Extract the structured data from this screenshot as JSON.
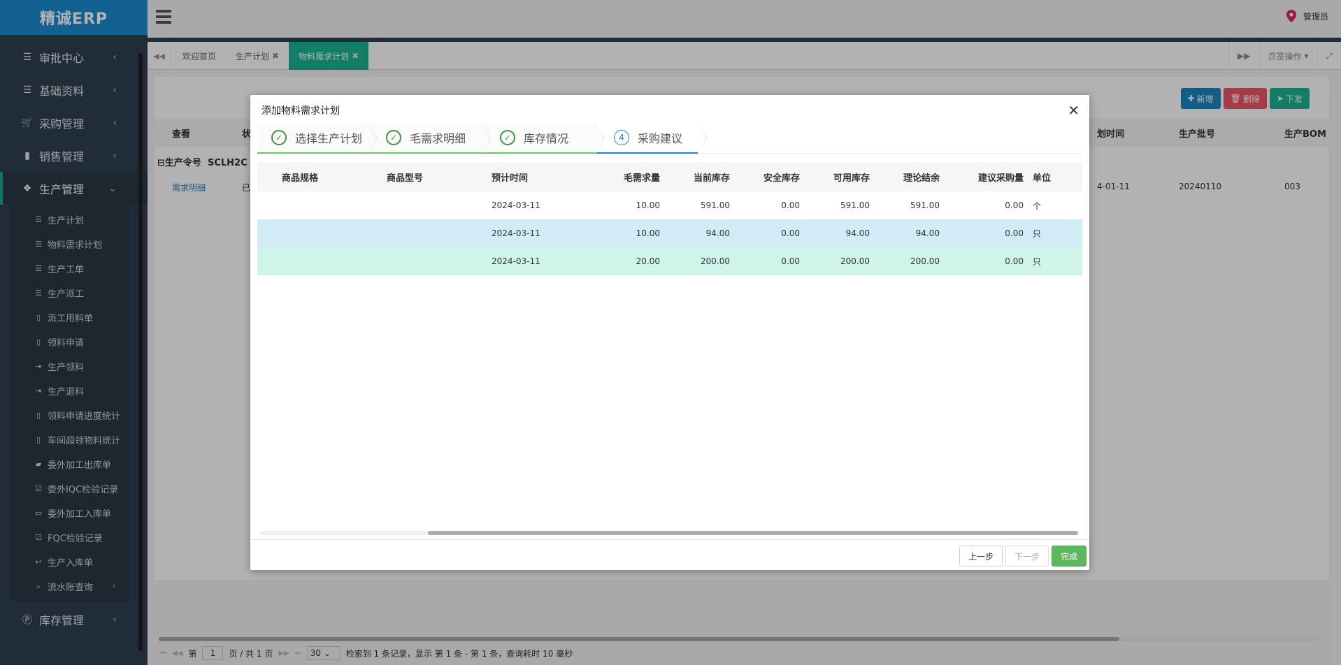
{
  "app": {
    "logo": "精诚ERP",
    "user": "管理员"
  },
  "sidebar": {
    "main_items": [
      {
        "label": "审批中心",
        "icon": "list-icon"
      },
      {
        "label": "基础资料",
        "icon": "list-icon"
      },
      {
        "label": "采购管理",
        "icon": "cart-icon"
      },
      {
        "label": "销售管理",
        "icon": "book-icon"
      },
      {
        "label": "生产管理",
        "icon": "cubes-icon"
      }
    ],
    "sub_items": [
      "生产计划",
      "物料需求计划",
      "生产工单",
      "生产派工",
      "派工用料单",
      "领料申请",
      "生产领料",
      "生产退料",
      "领料申请进度统计",
      "车间超领物料统计",
      "委外加工出库单",
      "委外IQC检验记录",
      "委外加工入库单",
      "FQC检验记录",
      "生产入库单",
      "流水账查询"
    ],
    "bottom_item": {
      "label": "库存管理",
      "icon": "p-circle-icon"
    }
  },
  "tabs": {
    "items": [
      "欢迎首页",
      "生产计划",
      "物料需求计划"
    ],
    "page_ops": "页签操作"
  },
  "toolbar": {
    "add": "新增",
    "delete": "删除",
    "issue": "下发"
  },
  "grid": {
    "headers": [
      "查看",
      "状",
      "划时间",
      "生产批号",
      "生产BOM"
    ],
    "group_label": "生产令号",
    "group_value": "SCLH2C",
    "row": {
      "link": "需求明细",
      "status": "已",
      "time": "4-01-11",
      "batch": "20240110",
      "bom": "003"
    }
  },
  "pager": {
    "page_prefix": "第",
    "page": "1",
    "page_suffix": "页 / 共 1 页",
    "page_size": "30",
    "summary": "检索到 1 条记录，显示 第 1 条 - 第 1 条，查询耗时 10 毫秒"
  },
  "modal": {
    "title": "添加物料需求计划",
    "steps": [
      "选择生产计划",
      "毛需求明细",
      "库存情况",
      "采购建议"
    ],
    "current_step_number": "4",
    "columns": [
      "商品规格",
      "商品型号",
      "预计时间",
      "毛需求量",
      "当前库存",
      "安全库存",
      "可用库存",
      "理论结余",
      "建议采购量",
      "单位"
    ],
    "rows": [
      {
        "spec": "",
        "model": "",
        "date": "2024-03-11",
        "gross": "10.00",
        "current": "591.00",
        "safety": "0.00",
        "available": "591.00",
        "balance": "591.00",
        "suggest": "0.00",
        "unit": "个"
      },
      {
        "spec": "",
        "model": "",
        "date": "2024-03-11",
        "gross": "10.00",
        "current": "94.00",
        "safety": "0.00",
        "available": "94.00",
        "balance": "94.00",
        "suggest": "0.00",
        "unit": "只"
      },
      {
        "spec": "",
        "model": "",
        "date": "2024-03-11",
        "gross": "20.00",
        "current": "200.00",
        "safety": "0.00",
        "available": "200.00",
        "balance": "200.00",
        "suggest": "0.00",
        "unit": "只"
      }
    ],
    "buttons": {
      "prev": "上一步",
      "next": "下一步",
      "finish": "完成"
    }
  },
  "colors": {
    "brand": "#1b8bd0",
    "accent": "#1ab394",
    "danger": "#ed5565",
    "step_done": "#3a9a3a",
    "step_current": "#1c84c6"
  }
}
